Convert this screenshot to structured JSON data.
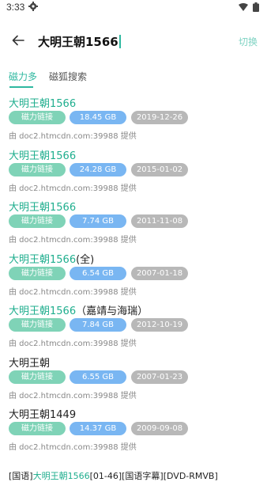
{
  "status_bar": {
    "time": "3:33"
  },
  "header": {
    "query": "大明王朝1566",
    "switch_label": "切换"
  },
  "tabs": [
    {
      "label": "磁力多",
      "active": true
    },
    {
      "label": "磁狐搜索",
      "active": false
    }
  ],
  "results": [
    {
      "highlight": "大明王朝1566",
      "rest": "",
      "link_label": "磁力链接",
      "size": "18.45 GB",
      "date": "2019-12-26",
      "source": "由 doc2.htmcdn.com:39988 提供"
    },
    {
      "highlight": "大明王朝1566",
      "rest": "",
      "link_label": "磁力链接",
      "size": "24.28 GB",
      "date": "2015-01-02",
      "source": "由 doc2.htmcdn.com:39988 提供"
    },
    {
      "highlight": "大明王朝1566",
      "rest": "",
      "link_label": "磁力链接",
      "size": "7.74 GB",
      "date": "2011-11-08",
      "source": "由 doc2.htmcdn.com:39988 提供"
    },
    {
      "highlight": "大明王朝1566",
      "rest": "(全)",
      "link_label": "磁力链接",
      "size": "6.54 GB",
      "date": "2007-01-18",
      "source": "由 doc2.htmcdn.com:39988 提供"
    },
    {
      "highlight": "大明王朝1566",
      "rest": "（嘉靖与海瑞）",
      "link_label": "磁力链接",
      "size": "7.84 GB",
      "date": "2012-10-19",
      "source": "由 doc2.htmcdn.com:39988 提供"
    },
    {
      "highlight": "",
      "rest": "大明王朝",
      "link_label": "磁力链接",
      "size": "6.55 GB",
      "date": "2007-01-23",
      "source": "由 doc2.htmcdn.com:39988 提供"
    },
    {
      "highlight": "",
      "rest": "大明王朝1449",
      "link_label": "磁力链接",
      "size": "14.37 GB",
      "date": "2009-09-08",
      "source": "由 doc2.htmcdn.com:39988 提供"
    }
  ],
  "partial_result": {
    "prefix": "[国语]",
    "highlight": "大明王朝1566",
    "rest": "[01-46][国语字幕][DVD-RMVB]"
  },
  "colors": {
    "accent": "#2fb8a0",
    "link_chip": "#7fd3b7",
    "size_chip": "#79b6f2",
    "date_chip": "#b8b8b8"
  }
}
